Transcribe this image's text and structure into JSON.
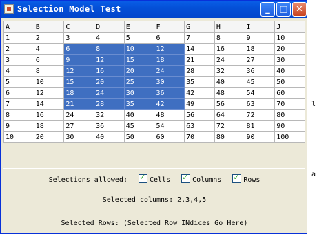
{
  "window": {
    "title": "Selection Model Test",
    "buttons": [
      "_",
      "□",
      "✕"
    ]
  },
  "table": {
    "headers": [
      "A",
      "B",
      "C",
      "D",
      "E",
      "F",
      "G",
      "H",
      "I",
      "J"
    ],
    "rows": [
      [
        1,
        2,
        3,
        4,
        5,
        6,
        7,
        8,
        9,
        10
      ],
      [
        2,
        4,
        6,
        8,
        10,
        12,
        14,
        16,
        18,
        20
      ],
      [
        3,
        6,
        9,
        12,
        15,
        18,
        21,
        24,
        27,
        30
      ],
      [
        4,
        8,
        12,
        16,
        20,
        24,
        28,
        32,
        36,
        40
      ],
      [
        5,
        10,
        15,
        20,
        25,
        30,
        35,
        40,
        45,
        50
      ],
      [
        6,
        12,
        18,
        24,
        30,
        36,
        42,
        48,
        54,
        60
      ],
      [
        7,
        14,
        21,
        28,
        35,
        42,
        49,
        56,
        63,
        70
      ],
      [
        8,
        16,
        24,
        32,
        40,
        48,
        56,
        64,
        72,
        80
      ],
      [
        9,
        18,
        27,
        36,
        45,
        54,
        63,
        72,
        81,
        90
      ],
      [
        10,
        20,
        30,
        40,
        50,
        60,
        70,
        80,
        90,
        100
      ]
    ],
    "selected_rows": [
      1,
      2,
      3,
      4,
      5,
      6
    ],
    "selected_cols": [
      2,
      3,
      4,
      5
    ]
  },
  "controls": {
    "allowed_label": "Selections allowed:",
    "checkboxes": [
      {
        "label": "Cells",
        "checked": true
      },
      {
        "label": "Columns",
        "checked": true
      },
      {
        "label": "Rows",
        "checked": true
      }
    ],
    "selected_columns_text": "Selected columns: 2,3,4,5",
    "selected_rows_text": "Selected Rows:  (Selected Row INdices Go Here)"
  },
  "background": {
    "side_chars": [
      "l",
      "a"
    ]
  }
}
